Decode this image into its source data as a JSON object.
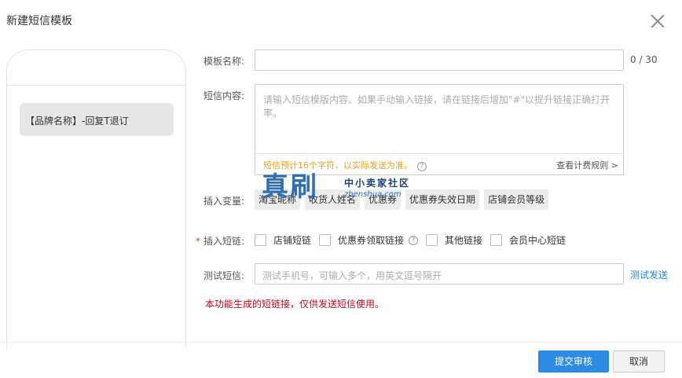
{
  "dialog": {
    "title": "新建短信模板"
  },
  "preview": {
    "message": "【品牌名称】-回复T退订"
  },
  "form": {
    "template_name": {
      "label": "模板名称:",
      "value": "",
      "counter": "0 / 30"
    },
    "content": {
      "label": "短信内容:",
      "placeholder": "请输入短信模版内容。如果手动输入链接，请在链接后增加\"#\"以提升链接正确打开率。",
      "estimate": "短信预计16个字符，以实际发送为准。",
      "help": "?",
      "billing_link": "查看计费规则 >"
    },
    "variables": {
      "label": "插入变量:",
      "tags": [
        "淘宝昵称",
        "收货人姓名",
        "优惠券",
        "优惠券失效日期",
        "店铺会员等级"
      ]
    },
    "short_links": {
      "required_mark": "*",
      "label": "插入短链:",
      "options": [
        "店铺短链",
        "优惠券领取链接",
        "其他链接",
        "会员中心短链"
      ],
      "help": "?"
    },
    "test_sms": {
      "label": "测试短信:",
      "placeholder": "测试手机号，可输入多个，用英文逗号隔开",
      "send_link": "测试发送"
    },
    "notice": "本功能生成的短链接，仅供发送短信使用。"
  },
  "footer": {
    "submit": "提交审核",
    "cancel": "取消"
  },
  "watermark": {
    "main": "真刷",
    "sub": "中小卖家社区",
    "en": "zhenshua.com"
  }
}
